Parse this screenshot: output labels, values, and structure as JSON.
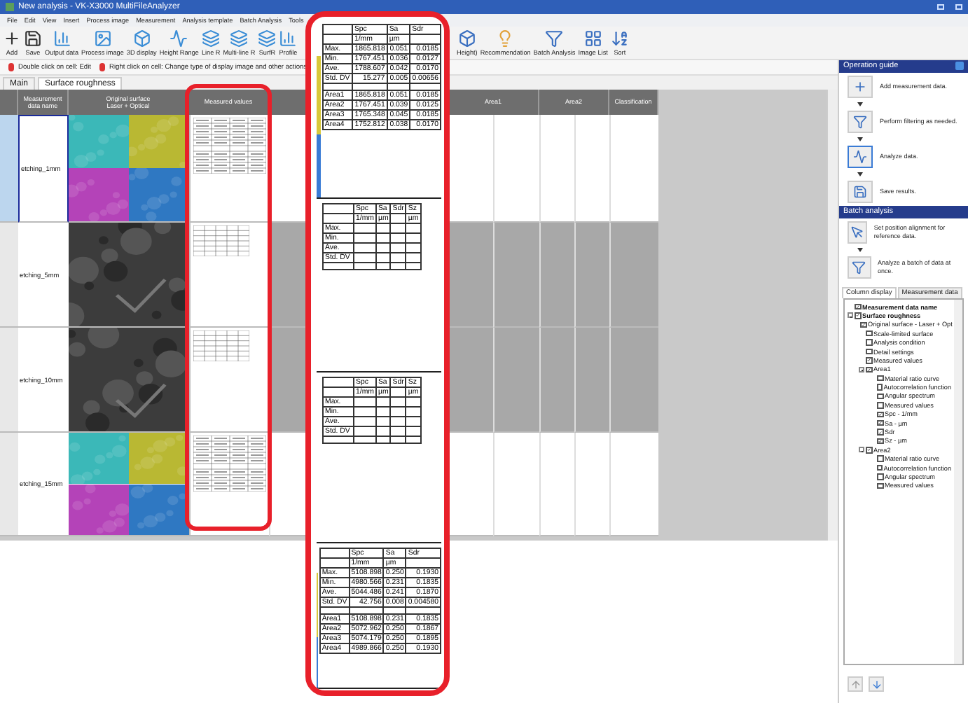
{
  "window": {
    "title": "New analysis - VK-X3000 MultiFileAnalyzer"
  },
  "menu": [
    "File",
    "Edit",
    "View",
    "Insert",
    "Process image",
    "Measurement",
    "Analysis template",
    "Batch Analysis",
    "Tools"
  ],
  "toolbar": {
    "left": [
      "Add",
      "Save",
      "Output data",
      "Process image",
      "3D display",
      "Height Range",
      "Line R",
      "Multi-line R",
      "SurfR",
      "Profile"
    ],
    "right": [
      "Height)",
      "Recommendation",
      "Batch Analysis",
      "Image List",
      "Sort"
    ]
  },
  "hints": [
    "Double click on cell: Edit",
    "Right click on cell: Change type of display image and other actions"
  ],
  "sheet_tabs": [
    {
      "label": "Main",
      "selected": false
    },
    {
      "label": "Surface roughness",
      "selected": true
    }
  ],
  "sheet": {
    "headers": {
      "name": "Measurement data name",
      "image_top": "Original surface",
      "image_bottom": "Laser + Optical",
      "values": "Measured values",
      "group_1": "Area1",
      "group_2": "Area2",
      "classification": "Classification"
    },
    "rows": [
      {
        "name": "etching_1mm",
        "selected": true,
        "kind": "areas"
      },
      {
        "name": "etching_5mm",
        "selected": false,
        "kind": "plain"
      },
      {
        "name": "etching_10mm",
        "selected": false,
        "kind": "plain"
      },
      {
        "name": "etching_15mm",
        "selected": false,
        "kind": "areas"
      }
    ]
  },
  "callout": {
    "sections": [
      {
        "kind": "values",
        "columns": [
          {
            "name": "Spc",
            "unit": "1/mm"
          },
          {
            "name": "Sa",
            "unit": "µm"
          },
          {
            "name": "Sdr"
          }
        ],
        "stats": [
          {
            "label": "Max.",
            "values": [
              "1865.818",
              "0.051",
              "0.0185"
            ]
          },
          {
            "label": "Min.",
            "values": [
              "1767.451",
              "0.036",
              "0.0127"
            ]
          },
          {
            "label": "Ave.",
            "values": [
              "1788.607",
              "0.042",
              "0.0170"
            ]
          },
          {
            "label": "Std. DV",
            "values": [
              "15.277",
              "0.005",
              "0.00656"
            ]
          }
        ],
        "areas": [
          {
            "label": "Area1",
            "values": [
              "1865.818",
              "0.051",
              "0.0185"
            ]
          },
          {
            "label": "Area2",
            "values": [
              "1767.451",
              "0.039",
              "0.0125"
            ]
          },
          {
            "label": "Area3",
            "values": [
              "1765.348",
              "0.045",
              "0.0185"
            ]
          },
          {
            "label": "Area4",
            "values": [
              "1752.812",
              "0.038",
              "0.0170"
            ]
          }
        ]
      },
      {
        "kind": "empty",
        "columns": [
          {
            "name": "Spc",
            "unit": "1/mm"
          },
          {
            "name": "Sa",
            "unit": "µm"
          },
          {
            "name": "Sdr"
          },
          {
            "name": "Sz",
            "unit": "µm"
          }
        ],
        "stats": [
          {
            "label": "Max."
          },
          {
            "label": "Min."
          },
          {
            "label": "Ave."
          },
          {
            "label": "Std. DV"
          }
        ]
      },
      {
        "kind": "empty",
        "columns": [
          {
            "name": "Spc",
            "unit": "1/mm"
          },
          {
            "name": "Sa",
            "unit": "µm"
          },
          {
            "name": "Sdr"
          },
          {
            "name": "Sz",
            "unit": "µm"
          }
        ],
        "stats": [
          {
            "label": "Max."
          },
          {
            "label": "Min."
          },
          {
            "label": "Ave."
          },
          {
            "label": "Std. DV"
          }
        ]
      },
      {
        "kind": "values",
        "columns": [
          {
            "name": "Spc",
            "unit": "1/mm"
          },
          {
            "name": "Sa",
            "unit": "µm"
          },
          {
            "name": "Sdr"
          }
        ],
        "stats": [
          {
            "label": "Max.",
            "values": [
              "5108.898",
              "0.250",
              "0.1930"
            ]
          },
          {
            "label": "Min.",
            "values": [
              "4980.566",
              "0.231",
              "0.1835"
            ]
          },
          {
            "label": "Ave.",
            "values": [
              "5044.486",
              "0.241",
              "0.1870"
            ]
          },
          {
            "label": "Std. DV",
            "values": [
              "42.756",
              "0.008",
              "0.004580"
            ]
          }
        ],
        "areas": [
          {
            "label": "Area1",
            "values": [
              "5108.898",
              "0.231",
              "0.1835"
            ]
          },
          {
            "label": "Area2",
            "values": [
              "5072.962",
              "0.250",
              "0.1867"
            ]
          },
          {
            "label": "Area3",
            "values": [
              "5074.179",
              "0.250",
              "0.1895"
            ]
          },
          {
            "label": "Area4",
            "values": [
              "4989.866",
              "0.250",
              "0.1930"
            ]
          }
        ]
      }
    ]
  },
  "operation_guide": {
    "title": "Operation guide",
    "steps": [
      "Add measurement data.",
      "Perform filtering as needed.",
      "Analyze data.",
      "Save results."
    ]
  },
  "batch_analysis": {
    "title": "Batch analysis",
    "steps": [
      "Set position alignment for reference data.",
      "Analyze a batch of data at once."
    ]
  },
  "panel_tabs": [
    {
      "label": "Column display",
      "selected": true
    },
    {
      "label": "Measurement data",
      "selected": false
    }
  ],
  "tree": [
    {
      "label": "Measurement data name",
      "checked": true
    },
    {
      "label": "Surface roughness",
      "checked": true,
      "expanded": true,
      "children": [
        {
          "label": "Original surface - Laser + Opt",
          "checked": true
        },
        {
          "label": "Scale-limited surface",
          "checked": false
        },
        {
          "label": "Analysis condition",
          "checked": false
        },
        {
          "label": "Detail settings",
          "checked": false
        },
        {
          "label": "Measured values",
          "checked": true
        },
        {
          "label": "Area1",
          "checked": true,
          "expanded": true,
          "children": [
            {
              "label": "Material ratio curve",
              "checked": false
            },
            {
              "label": "Autocorrelation function",
              "checked": false
            },
            {
              "label": "Angular spectrum",
              "checked": false
            },
            {
              "label": "Measured values",
              "checked": false
            },
            {
              "label": "Spc - 1/mm",
              "checked": true
            },
            {
              "label": "Sa - µm",
              "checked": true
            },
            {
              "label": "Sdr",
              "checked": true
            },
            {
              "label": "Sz - µm",
              "checked": true
            }
          ]
        },
        {
          "label": "Area2",
          "checked": true,
          "expanded": true,
          "children": [
            {
              "label": "Material ratio curve",
              "checked": false
            },
            {
              "label": "Autocorrelation function",
              "checked": false
            },
            {
              "label": "Angular spectrum",
              "checked": false
            },
            {
              "label": "Measured values",
              "checked": false
            }
          ]
        }
      ]
    }
  ]
}
